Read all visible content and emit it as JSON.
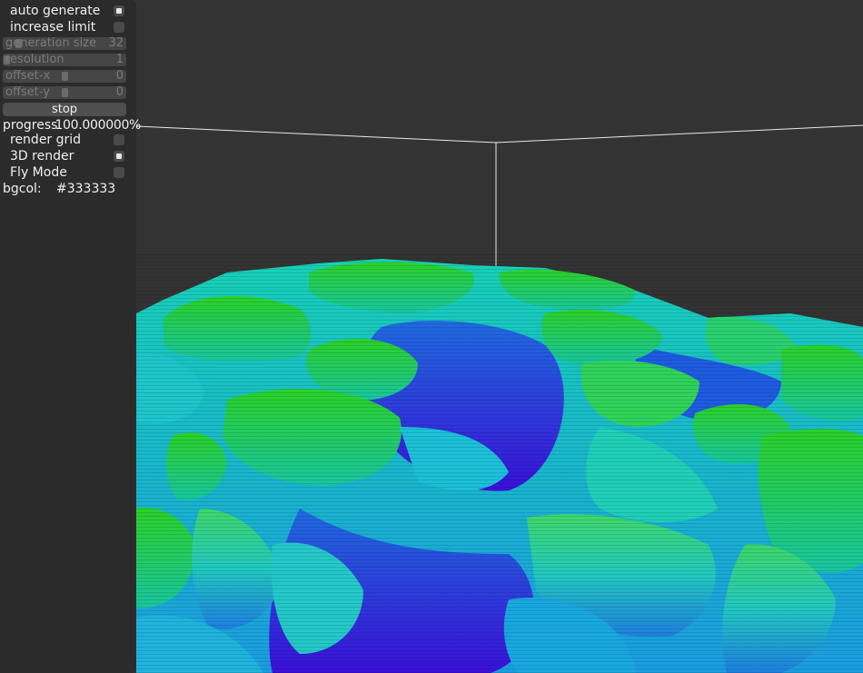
{
  "panel": {
    "auto_generate": {
      "label": "auto generate",
      "checked": true
    },
    "increase_limit": {
      "label": "increase limit",
      "checked": false
    },
    "generation_size": {
      "label": "generation size",
      "value": "32"
    },
    "resolution": {
      "label": "resolution",
      "value": "1"
    },
    "offset_x": {
      "label": "offset-x",
      "value": "0"
    },
    "offset_y": {
      "label": "offset-y",
      "value": "0"
    },
    "stop_label": "stop",
    "progress_label": "progress",
    "progress_value": "100.000000%",
    "render_grid": {
      "label": "render grid",
      "checked": false
    },
    "render_3d": {
      "label": "3D render",
      "checked": true
    },
    "fly_mode": {
      "label": "Fly Mode",
      "checked": false
    },
    "bgcol_label": "bgcol:",
    "bgcol_value": "#333333"
  },
  "colors": {
    "background": "#333333",
    "panel": "#2b2b2b",
    "terrain_low": "#2a10e0",
    "terrain_mid": "#10c0e8",
    "terrain_high": "#20d020"
  }
}
